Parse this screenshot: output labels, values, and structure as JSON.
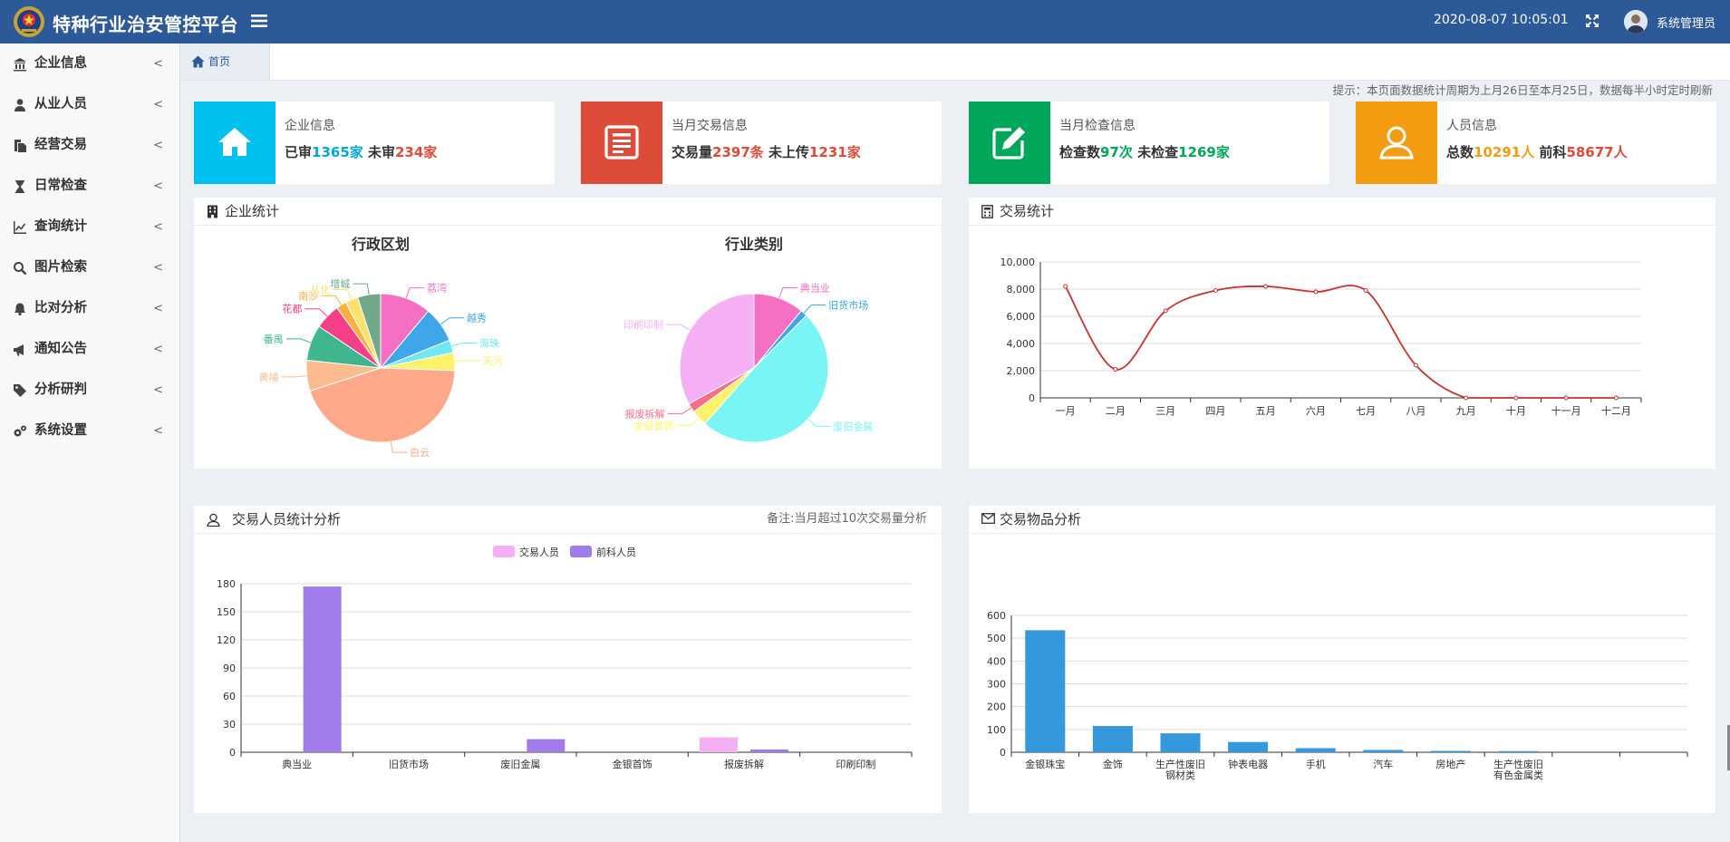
{
  "header": {
    "title": "特种行业治安管控平台",
    "datetime": "2020-08-07 10:05:01",
    "username": "系统管理员",
    "icons": {
      "logo": "police-emblem-icon",
      "menu": "hamburger-icon",
      "fullscreen": "expand-icon",
      "avatar": "user-avatar"
    }
  },
  "sidebar": {
    "items": [
      {
        "label": "企业信息",
        "icon": "bank-icon"
      },
      {
        "label": "从业人员",
        "icon": "user-icon"
      },
      {
        "label": "经营交易",
        "icon": "copy-icon"
      },
      {
        "label": "日常检查",
        "icon": "hourglass-icon"
      },
      {
        "label": "查询统计",
        "icon": "line-chart-icon"
      },
      {
        "label": "图片检索",
        "icon": "search-icon"
      },
      {
        "label": "比对分析",
        "icon": "bell-icon"
      },
      {
        "label": "通知公告",
        "icon": "bullhorn-icon"
      },
      {
        "label": "分析研判",
        "icon": "tag-icon"
      },
      {
        "label": "系统设置",
        "icon": "gears-icon"
      }
    ],
    "chevron": "<"
  },
  "tabs": {
    "home": "首页"
  },
  "notice": "提示：本页面数据统计周期为上月26日至本月25日，数据每半小时定时刷新",
  "cards": [
    {
      "title": "企业信息",
      "color": "#00c0ef",
      "parts": [
        {
          "text": "已审",
          "color": "#333"
        },
        {
          "text": "1365家",
          "color": "#00a7d0"
        },
        {
          "text": " 未审",
          "color": "#333"
        },
        {
          "text": "234家",
          "color": "#dd4b39"
        }
      ]
    },
    {
      "title": "当月交易信息",
      "color": "#dd4b39",
      "parts": [
        {
          "text": "交易量",
          "color": "#333"
        },
        {
          "text": "2397条",
          "color": "#dd4b39"
        },
        {
          "text": " 未上传",
          "color": "#333"
        },
        {
          "text": "1231家",
          "color": "#dd4b39"
        }
      ]
    },
    {
      "title": "当月检查信息",
      "color": "#00a65a",
      "parts": [
        {
          "text": "检查数",
          "color": "#333"
        },
        {
          "text": "97次",
          "color": "#00a65a"
        },
        {
          "text": " 未检查",
          "color": "#333"
        },
        {
          "text": "1269家",
          "color": "#00a65a"
        }
      ]
    },
    {
      "title": "人员信息",
      "color": "#f39c12",
      "parts": [
        {
          "text": "总数",
          "color": "#333"
        },
        {
          "text": "10291人",
          "color": "#f39c12"
        },
        {
          "text": " 前科",
          "color": "#333"
        },
        {
          "text": "58677人",
          "color": "#dd4b39"
        }
      ]
    }
  ],
  "panels": {
    "enterprise": {
      "title": "企业统计",
      "icon": "building-icon"
    },
    "trade": {
      "title": "交易统计",
      "icon": "calculator-icon"
    },
    "people": {
      "title": "交易人员统计分析",
      "note": "备注:当月超过10次交易量分析",
      "icon": "user-outline-icon"
    },
    "goods": {
      "title": "交易物品分析",
      "icon": "envelope-icon"
    }
  },
  "chart_data": [
    {
      "type": "pie",
      "title": "行政区划",
      "categories": [
        "荔湾",
        "越秀",
        "海珠",
        "天河",
        "白云",
        "黄埔",
        "番禺",
        "花都",
        "南沙",
        "从化",
        "增城"
      ],
      "values": [
        10,
        7,
        2.5,
        3.5,
        40,
        6,
        7,
        5,
        2,
        2.5,
        4.5
      ],
      "colors": [
        "#f56fc2",
        "#3fa7e9",
        "#6fe8f5",
        "#fff26b",
        "#ffa98a",
        "#fdbc8f",
        "#3fb68e",
        "#f53f88",
        "#fcb13f",
        "#fde16f",
        "#6fa88a"
      ]
    },
    {
      "type": "pie",
      "title": "行业类别",
      "categories": [
        "典当业",
        "旧货市场",
        "废旧金属",
        "金银首饰",
        "报废拆解",
        "印刷印制"
      ],
      "values": [
        11,
        1.5,
        49,
        3.5,
        2,
        33
      ],
      "colors": [
        "#f56fc2",
        "#3fa7e9",
        "#7af5f5",
        "#fff26b",
        "#f56f8a",
        "#f5b0f5"
      ]
    },
    {
      "type": "line",
      "categories": [
        "一月",
        "二月",
        "三月",
        "四月",
        "五月",
        "六月",
        "七月",
        "八月",
        "九月",
        "十月",
        "十一月",
        "十二月"
      ],
      "values": [
        8200,
        2100,
        6400,
        7900,
        8200,
        7800,
        7900,
        2400,
        0,
        0,
        0,
        0
      ],
      "ylim": [
        0,
        10000
      ],
      "yticks": [
        "0",
        "2,000",
        "4,000",
        "6,000",
        "8,000",
        "10,000"
      ],
      "color": "#c23531",
      "grid": true
    },
    {
      "type": "bar",
      "categories": [
        "典当业",
        "旧货市场",
        "废旧金属",
        "金银首饰",
        "报废拆解",
        "印刷印制"
      ],
      "series": [
        {
          "name": "交易人员",
          "values": [
            0,
            0,
            0,
            0,
            16,
            0
          ],
          "color": "#f5b0f5"
        },
        {
          "name": "前科人员",
          "values": [
            177,
            0,
            14,
            0,
            3,
            0
          ],
          "color": "#a07cea"
        }
      ],
      "ylim": [
        0,
        180
      ],
      "yticks": [
        "0",
        "30",
        "60",
        "90",
        "120",
        "150",
        "180"
      ],
      "legend": "top-center",
      "grid": true
    },
    {
      "type": "bar",
      "categories": [
        "金银珠宝",
        "金饰",
        "生产性废旧\n钢材类",
        "钟表电器",
        "手机",
        "汽车",
        "房地产",
        "生产性废旧\n有色金属类",
        "",
        ""
      ],
      "values": [
        535,
        115,
        83,
        45,
        18,
        10,
        6,
        5,
        0,
        0
      ],
      "ylim": [
        0,
        600
      ],
      "yticks": [
        "0",
        "100",
        "200",
        "300",
        "400",
        "500",
        "600"
      ],
      "color": "#3498db",
      "grid": true
    }
  ]
}
